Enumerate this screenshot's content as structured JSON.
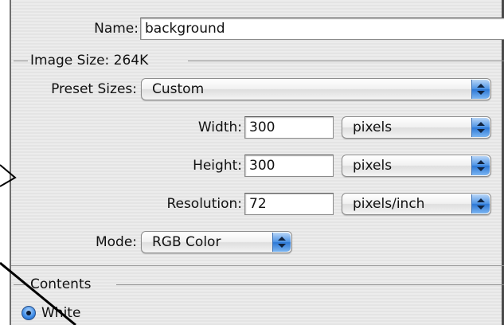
{
  "name": {
    "label": "Name:",
    "value": "background"
  },
  "image_size": {
    "label": "Image Size: 264K"
  },
  "preset_sizes": {
    "label": "Preset Sizes:",
    "selected": "Custom"
  },
  "width": {
    "label": "Width:",
    "value": "300",
    "unit": "pixels"
  },
  "height": {
    "label": "Height:",
    "value": "300",
    "unit": "pixels"
  },
  "resolution": {
    "label": "Resolution:",
    "value": "72",
    "unit": "pixels/inch"
  },
  "mode": {
    "label": "Mode:",
    "selected": "RGB Color"
  },
  "contents": {
    "label": "Contents",
    "option_white": "White",
    "selected": "White"
  },
  "colors": {
    "accent": "#3c8ae6",
    "dialog_bg": "#ececec",
    "annotation": "#000000"
  },
  "icons": {
    "popup_arrows": "updown-arrows-icon",
    "radio": "radio-selected-icon",
    "annotation": "arrow-line-annotation"
  }
}
